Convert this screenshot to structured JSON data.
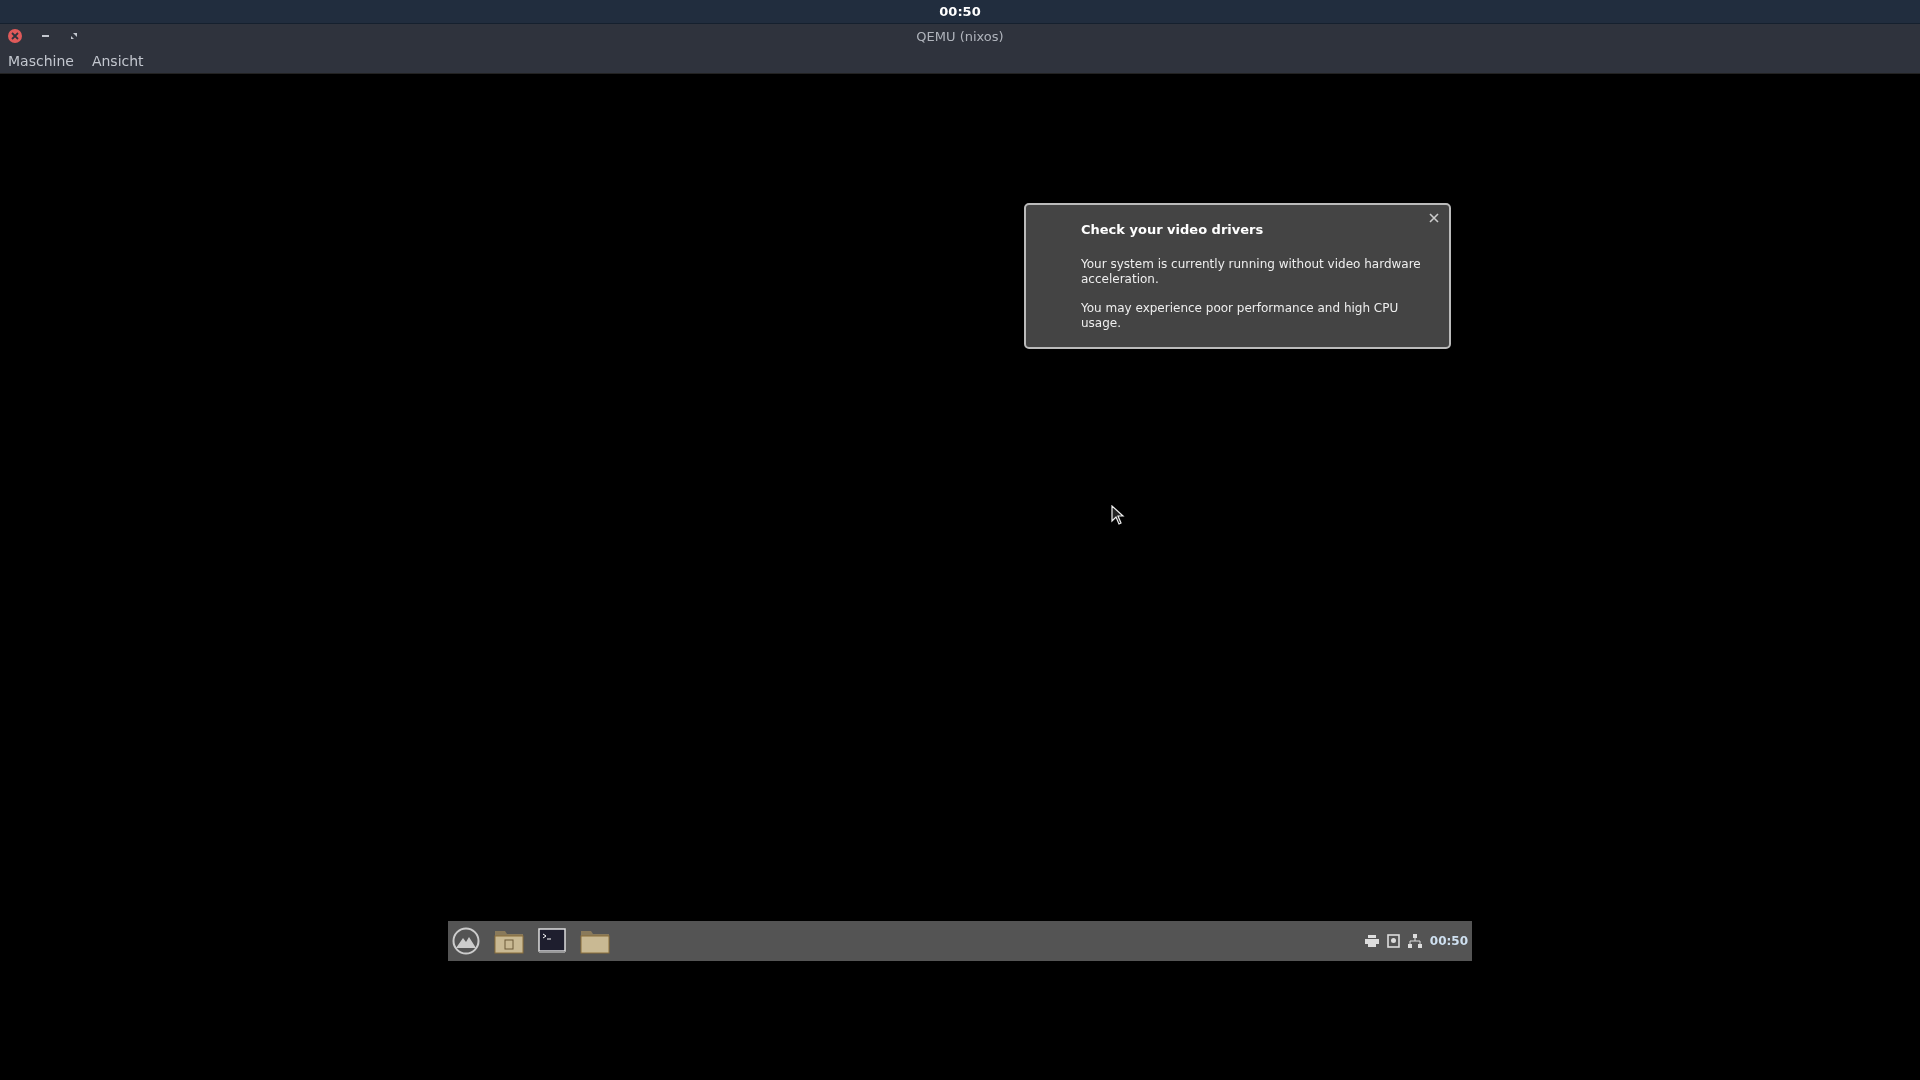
{
  "top_panel": {
    "clock": "00:50"
  },
  "window": {
    "title": "QEMU (nixos)"
  },
  "menu": [
    "Maschine",
    "Ansicht"
  ],
  "notification": {
    "title": "Check your video drivers",
    "paragraphs": [
      "Your system is currently running without video hardware acceleration.",
      "You may experience poor performance and high CPU usage."
    ]
  },
  "taskbar": {
    "clock": "00:50"
  }
}
